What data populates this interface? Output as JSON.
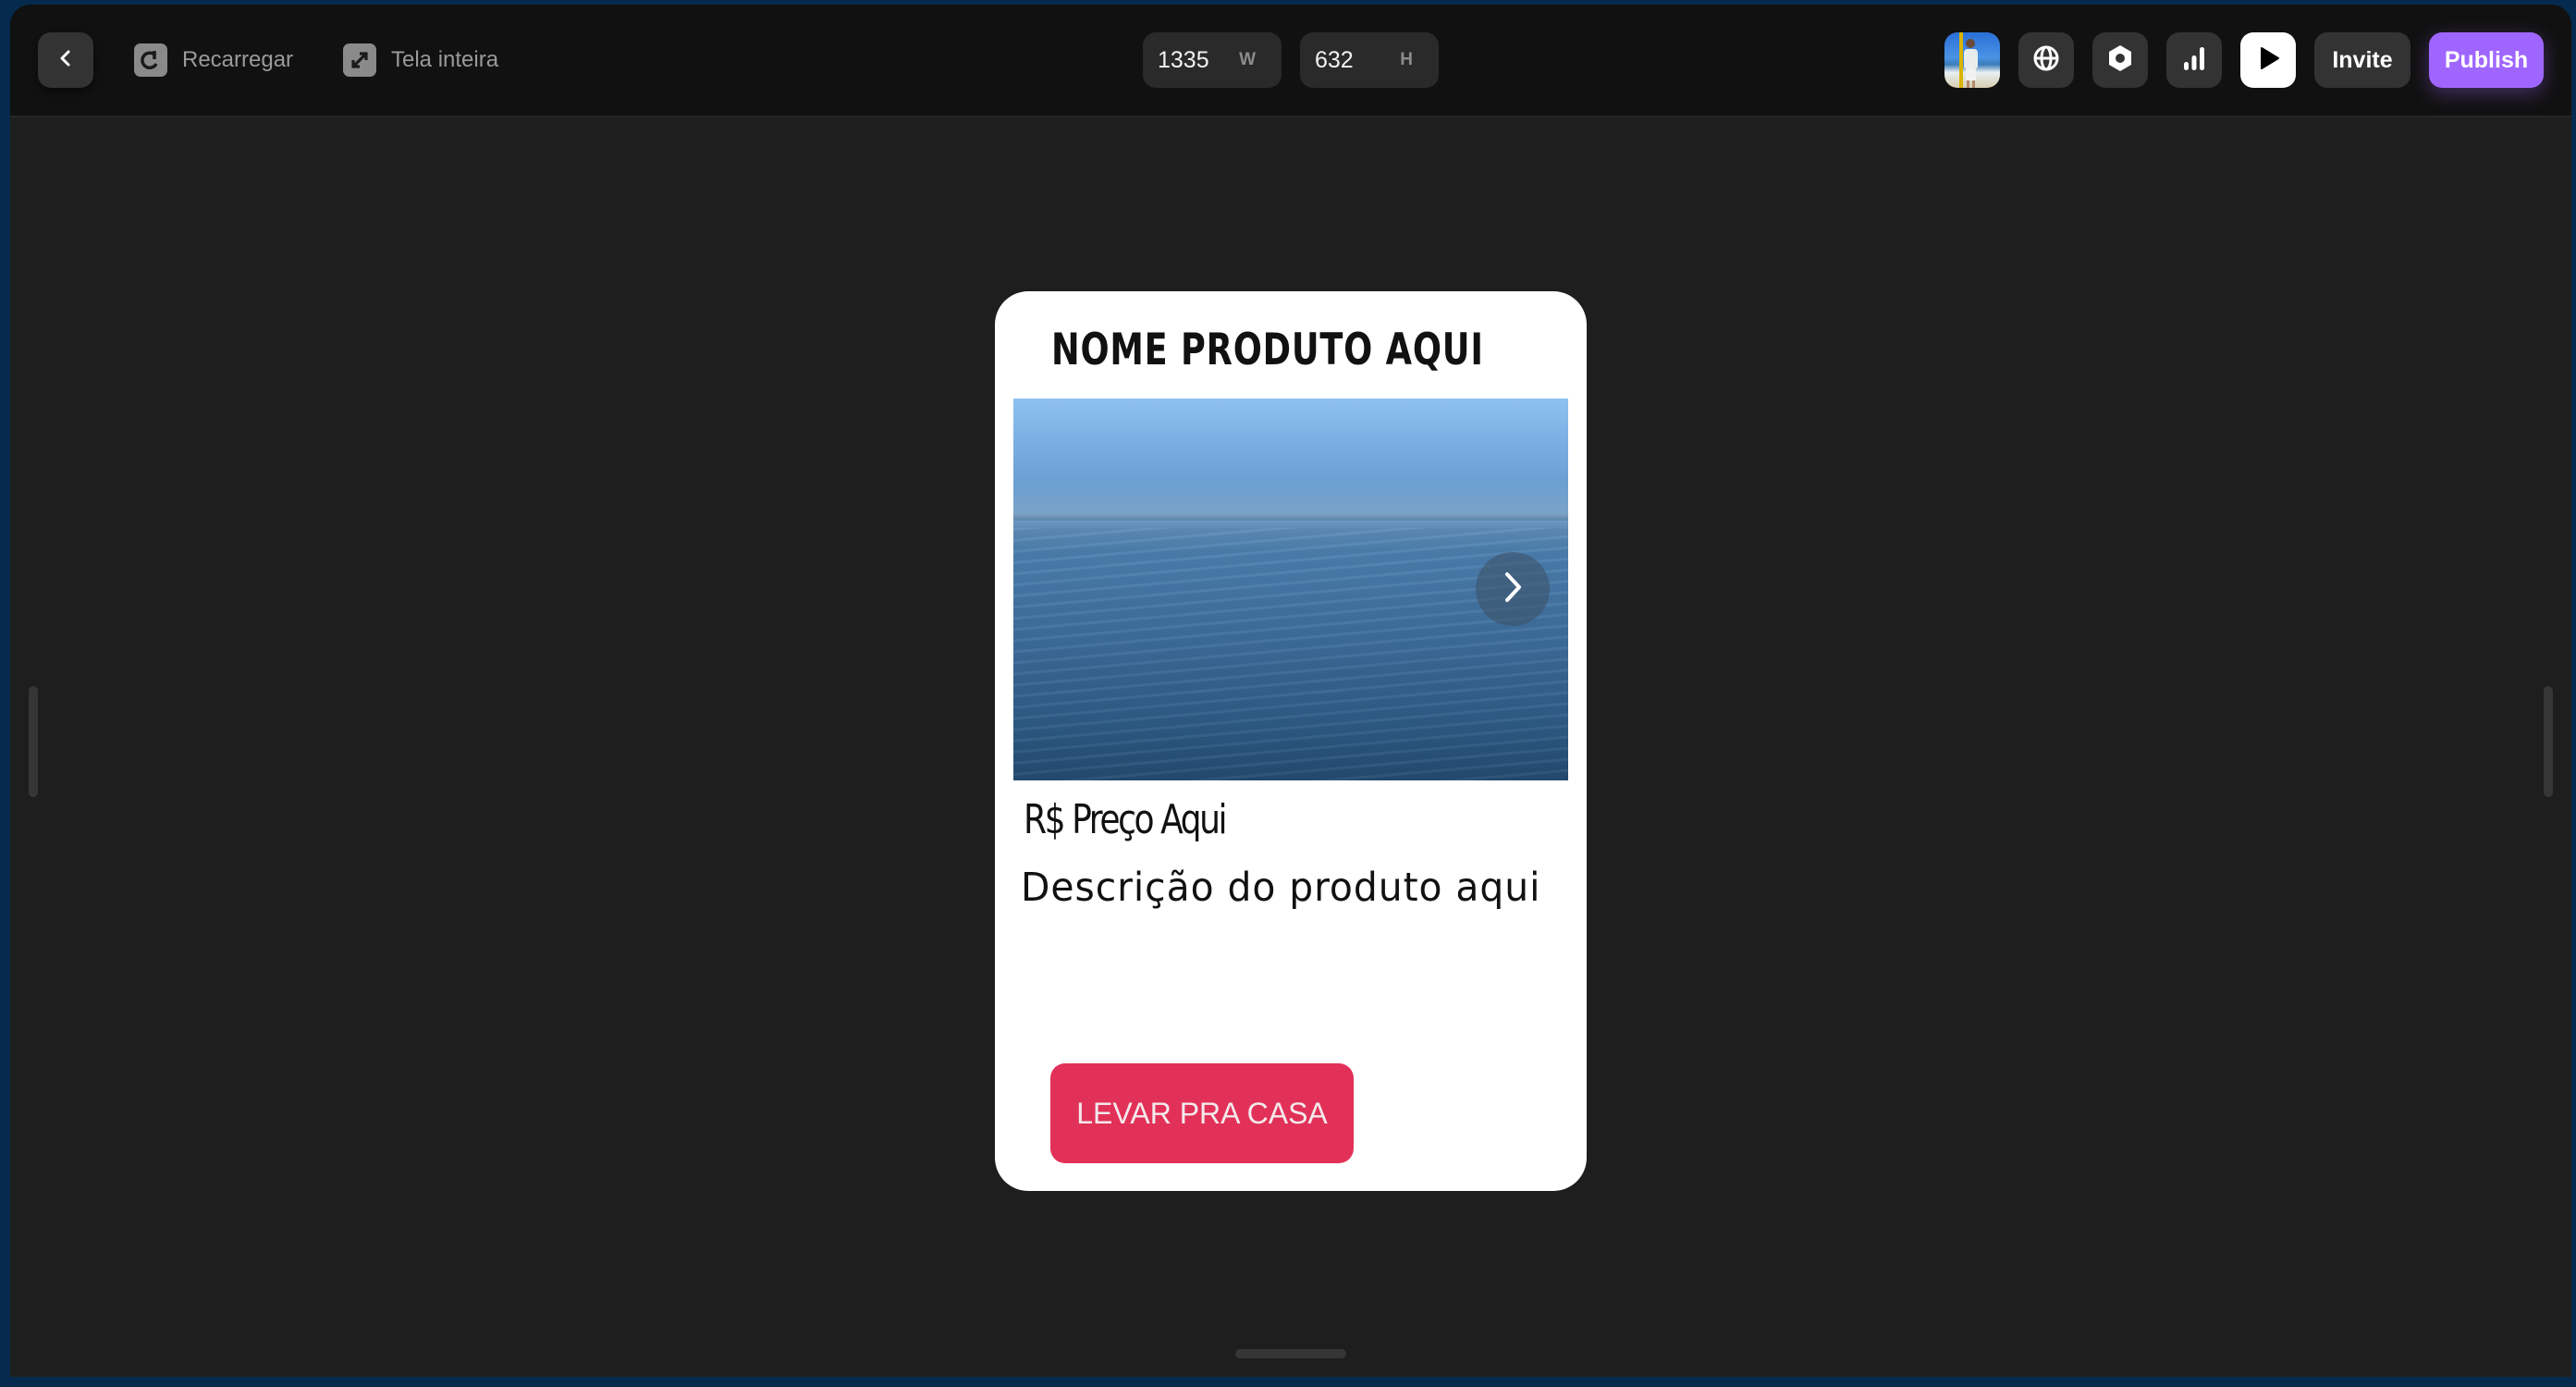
{
  "toolbar": {
    "back_icon": "chevron-left-icon",
    "reload": {
      "label": "Recarregar",
      "icon": "reload-icon"
    },
    "fullscreen": {
      "label": "Tela inteira",
      "icon": "expand-icon"
    },
    "width": {
      "value": "1335",
      "unit": "W"
    },
    "height": {
      "value": "632",
      "unit": "H"
    },
    "icons": [
      "avatar",
      "globe-icon",
      "settings-hex-icon",
      "analytics-bars-icon",
      "play-icon"
    ],
    "invite_label": "Invite",
    "publish_label": "Publish",
    "colors": {
      "publish": "#9f66ff",
      "toolbar_bg": "#111111"
    }
  },
  "card": {
    "title": "NOME PRODUTO AQUI",
    "image_alt": "Ocean horizon photo",
    "next_icon": "chevron-right-icon",
    "price": "R$ Preço Aqui",
    "description": "Descrição do produto aqui",
    "cta_label": "LEVAR PRA CASA",
    "colors": {
      "cta": "#e23158",
      "background": "#ffffff"
    }
  },
  "canvas": {
    "background": "#1e1e1e",
    "frame_border": "#062a4d"
  }
}
